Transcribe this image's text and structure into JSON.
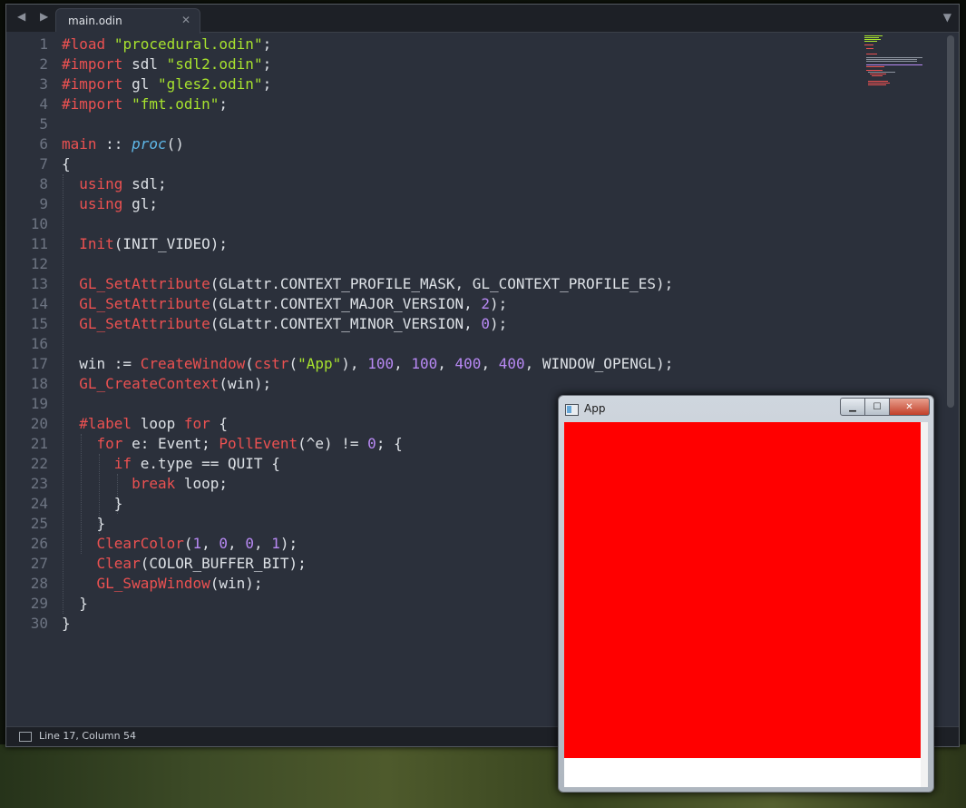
{
  "editor": {
    "nav_arrows": "◀ ▶",
    "tab_label": "main.odin",
    "tab_close": "✕",
    "tab_menu": "▼",
    "status": "Line 17, Column 54"
  },
  "line_numbers": [
    "1",
    "2",
    "3",
    "4",
    "5",
    "6",
    "7",
    "8",
    "9",
    "10",
    "11",
    "12",
    "13",
    "14",
    "15",
    "16",
    "17",
    "18",
    "19",
    "20",
    "21",
    "22",
    "23",
    "24",
    "25",
    "26",
    "27",
    "28",
    "29",
    "30"
  ],
  "app_window": {
    "title": "App",
    "min_label": "▁",
    "max_label": "☐",
    "close_label": "✕",
    "render_color": "#ff0000"
  },
  "colors": {
    "keyword": "#eb5151",
    "string": "#a7e22e",
    "number": "#b889f4",
    "type": "#5fb8e8",
    "editor_bg": "#2b303b"
  }
}
